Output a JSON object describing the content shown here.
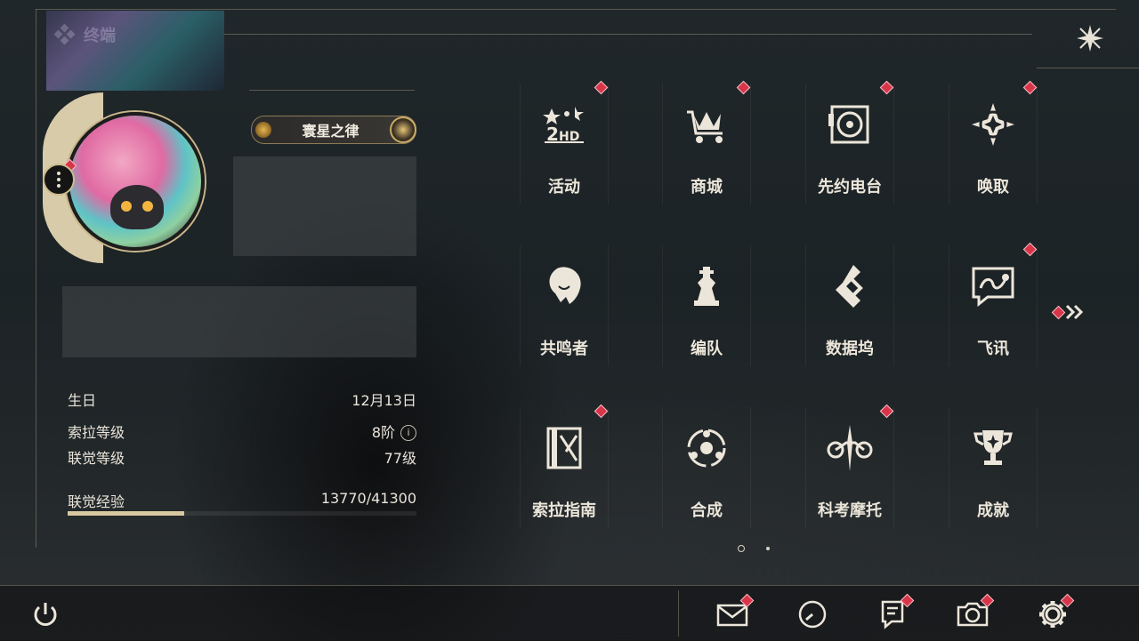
{
  "window": {
    "title": "终端"
  },
  "profile": {
    "title_badge": "寰星之律",
    "stats": [
      {
        "label": "生日",
        "value": "12月13日"
      },
      {
        "label": "索拉等级",
        "value": "8阶"
      },
      {
        "label": "联觉等级",
        "value": "77级"
      },
      {
        "label": "联觉经验",
        "value": "13770/41300"
      }
    ],
    "exp_progress": 0.333
  },
  "menu": {
    "items": [
      {
        "label": "活动",
        "icon": "event-2hd-icon",
        "badge": true
      },
      {
        "label": "商城",
        "icon": "crown-cart-icon",
        "badge": true
      },
      {
        "label": "先约电台",
        "icon": "radio-record-icon",
        "badge": true
      },
      {
        "label": "唤取",
        "icon": "compass-star-icon",
        "badge": true
      },
      {
        "label": "共鸣者",
        "icon": "character-head-icon",
        "badge": false
      },
      {
        "label": "编队",
        "icon": "chess-piece-icon",
        "badge": false
      },
      {
        "label": "数据坞",
        "icon": "data-dock-icon",
        "badge": false
      },
      {
        "label": "飞讯",
        "icon": "chat-bubble-icon",
        "badge": true
      },
      {
        "label": "索拉指南",
        "icon": "guidebook-icon",
        "badge": true
      },
      {
        "label": "合成",
        "icon": "synthesis-orb-icon",
        "badge": false
      },
      {
        "label": "科考摩托",
        "icon": "motorbike-icon",
        "badge": true
      },
      {
        "label": "成就",
        "icon": "trophy-icon",
        "badge": false
      }
    ],
    "pages": 2,
    "current_page": 1
  },
  "bottom_bar": {
    "left_icon": "power-icon",
    "right_icons": [
      "mail-icon",
      "clock-icon",
      "notice-icon",
      "camera-icon",
      "settings-gear-icon"
    ]
  }
}
